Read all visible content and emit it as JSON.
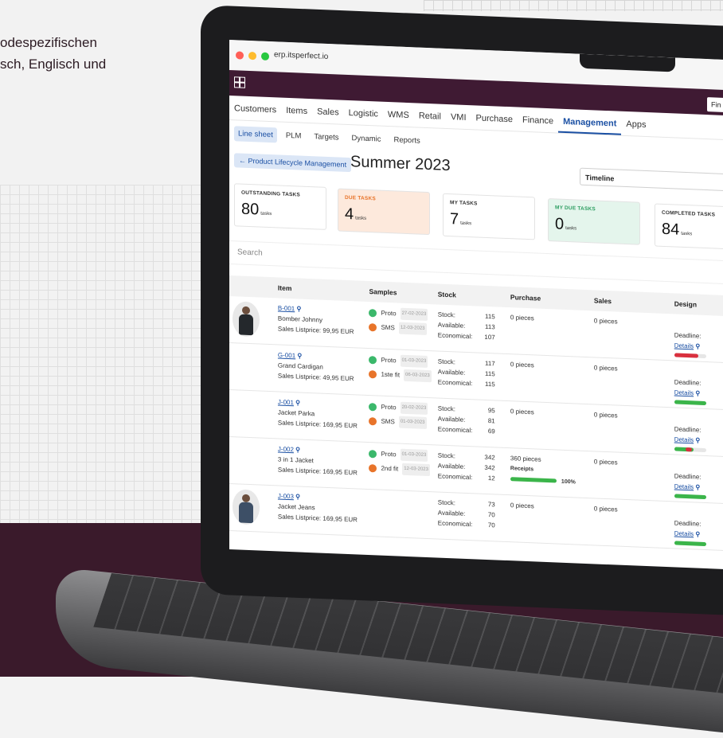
{
  "marketing": {
    "line1": "odespezifischen",
    "line2": "sch, Englisch und"
  },
  "browser": {
    "url": "erp.itsperfect.io",
    "find_label": "Fin"
  },
  "nav": {
    "tabs": [
      "Customers",
      "Items",
      "Sales",
      "Logistic",
      "WMS",
      "Retail",
      "VMI",
      "Purchase",
      "Finance",
      "Management",
      "Apps"
    ],
    "active": "Management"
  },
  "subtabs": {
    "items": [
      "Line sheet",
      "PLM",
      "Targets",
      "Dynamic",
      "Reports"
    ],
    "active": "Line sheet"
  },
  "header": {
    "breadcrumb": "← Product Lifecycle Management",
    "title": "Summer 2023",
    "view_select": "Timeline"
  },
  "cards": [
    {
      "label": "OUTSTANDING TASKS",
      "value": "80",
      "unit": "tasks",
      "bg": "#ffffff",
      "color": "#333333"
    },
    {
      "label": "DUE TASKS",
      "value": "4",
      "unit": "tasks",
      "bg": "#fde9dc",
      "color": "#e8742a"
    },
    {
      "label": "MY TASKS",
      "value": "7",
      "unit": "tasks",
      "bg": "#ffffff",
      "color": "#333333"
    },
    {
      "label": "MY DUE TASKS",
      "value": "0",
      "unit": "tasks",
      "bg": "#e4f5ec",
      "color": "#2f9f63"
    },
    {
      "label": "COMPLETED TASKS",
      "value": "84",
      "unit": "tasks",
      "bg": "#ffffff",
      "color": "#333333"
    }
  ],
  "search": {
    "placeholder": "Search"
  },
  "table": {
    "columns": [
      "Item",
      "Samples",
      "Stock",
      "Purchase",
      "Sales",
      "Design"
    ],
    "stock_labels": {
      "stock": "Stock:",
      "available": "Available:",
      "economical": "Economical:"
    },
    "deadline_label": "Deadline:",
    "details_label": "Details",
    "rows": [
      {
        "code": "B-001",
        "name": "Bomber Johnny",
        "price": "Sales Listprice: 99,95 EUR",
        "image": "dark",
        "samples": [
          {
            "name": "Proto",
            "date": "27-02-2023",
            "color": "#3bb86b"
          },
          {
            "name": "SMS",
            "date": "12-03-2023",
            "color": "#e8742a"
          }
        ],
        "stock": "115",
        "available": "113",
        "economical": "107",
        "purchase": "0 pieces",
        "sales": "0 pieces",
        "design_progress": 0.75,
        "design_color": "#d9303e"
      },
      {
        "code": "G-001",
        "name": "Grand Cardigan",
        "price": "Sales Listprice: 49,95 EUR",
        "image": "",
        "samples": [
          {
            "name": "Proto",
            "date": "01-03-2023",
            "color": "#3bb86b"
          },
          {
            "name": "1ste fit",
            "date": "06-03-2023",
            "color": "#e8742a"
          }
        ],
        "stock": "117",
        "available": "115",
        "economical": "115",
        "purchase": "0 pieces",
        "sales": "0 pieces",
        "design_progress": 1,
        "design_color": "#3bb54a"
      },
      {
        "code": "J-001",
        "name": "Jacket Parka",
        "price": "Sales Listprice: 169,95 EUR",
        "image": "",
        "samples": [
          {
            "name": "Proto",
            "date": "20-02-2023",
            "color": "#3bb86b"
          },
          {
            "name": "SMS",
            "date": "01-03-2023",
            "color": "#e8742a"
          }
        ],
        "stock": "95",
        "available": "81",
        "economical": "69",
        "purchase": "0 pieces",
        "sales": "0 pieces",
        "design_progress": 0.6,
        "design_color": "#3bb54a",
        "design_alert": true
      },
      {
        "code": "J-002",
        "name": "3 in 1 Jacket",
        "price": "Sales Listprice: 169,95 EUR",
        "image": "",
        "samples": [
          {
            "name": "Proto",
            "date": "01-03-2023",
            "color": "#3bb86b"
          },
          {
            "name": "2nd fit",
            "date": "12-03-2023",
            "color": "#e8742a"
          }
        ],
        "stock": "342",
        "available": "342",
        "economical": "12",
        "purchase": "360 pieces",
        "receipts_label": "Receipts",
        "receipts_pct": "100%",
        "sales": "0 pieces",
        "design_progress": 1,
        "design_color": "#3bb54a"
      },
      {
        "code": "J-003",
        "name": "Jacket Jeans",
        "price": "Sales Listprice: 169,95 EUR",
        "image": "blue",
        "samples": [],
        "stock": "73",
        "available": "70",
        "economical": "70",
        "purchase": "0 pieces",
        "sales": "0 pieces",
        "design_progress": 1,
        "design_color": "#3bb54a"
      }
    ]
  }
}
